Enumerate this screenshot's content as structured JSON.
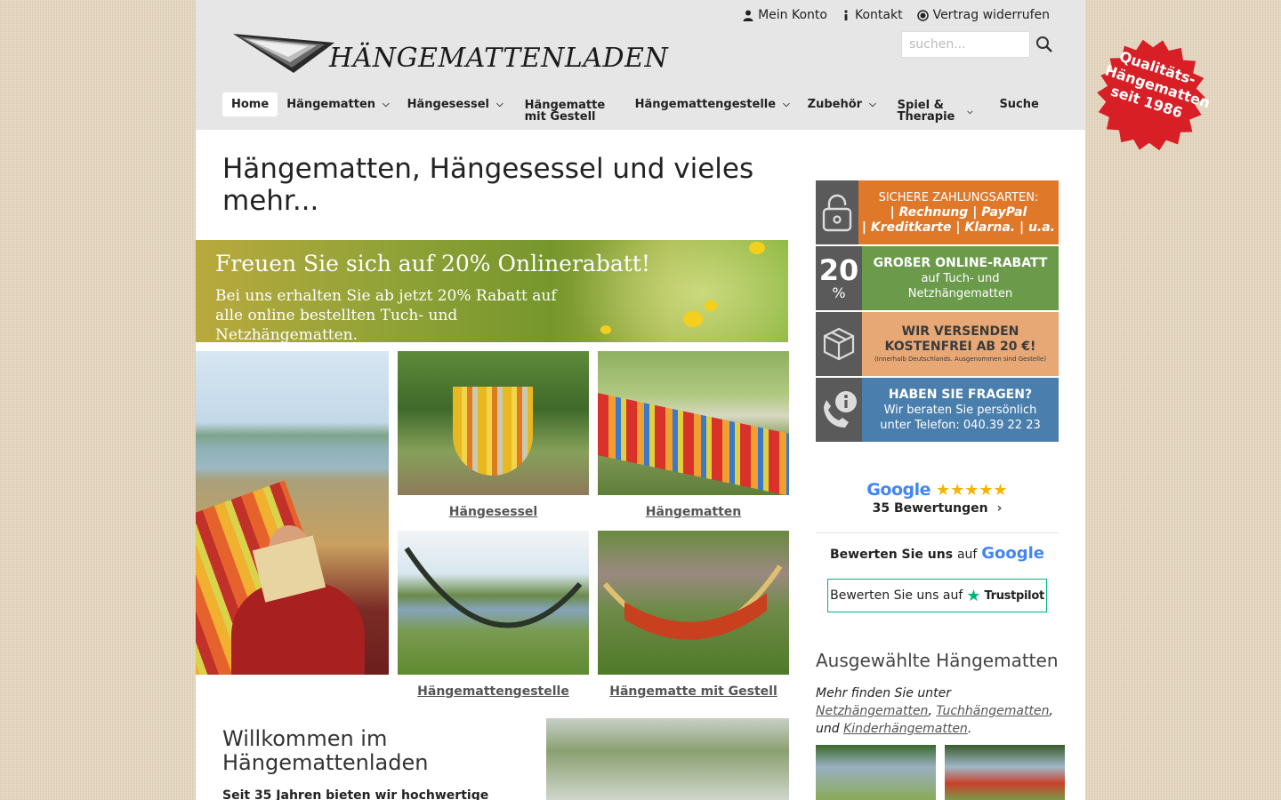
{
  "header": {
    "top_links": [
      {
        "label": "Mein Konto",
        "icon": "user-icon"
      },
      {
        "label": "Kontakt",
        "icon": "info-icon"
      },
      {
        "label": "Vertrag widerrufen",
        "icon": "radio-icon"
      }
    ],
    "logo_text": "HÄNGEMATTENLADEN",
    "search_placeholder": "suchen...",
    "nav": [
      {
        "label": "Home",
        "active": true
      },
      {
        "label": "Hängematten",
        "dropdown": true
      },
      {
        "label": "Hängesessel",
        "dropdown": true
      },
      {
        "label": "Hängematte",
        "label2": "mit Gestell"
      },
      {
        "label": "Hängemattengestelle",
        "dropdown": true
      },
      {
        "label": "Zubehör",
        "dropdown": true
      },
      {
        "label": "Spiel &",
        "label2": "Therapie",
        "dropdown": true
      },
      {
        "label": "Suche"
      }
    ]
  },
  "seal": {
    "line1": "Qualitäts-",
    "line2": "Hängematten",
    "line3": "seit 1986"
  },
  "main": {
    "title": "Hängematten, Hängesessel und vieles mehr...",
    "promo": {
      "title": "Freuen Sie sich auf 20% Onlinerabatt!",
      "text": "Bei uns erhalten Sie ab jetzt 20% Rabatt auf alle online bestellten Tuch- und Netzhängematten."
    },
    "categories": [
      "Hängesessel",
      "Hängematten",
      "Hängemattengestelle",
      "Hängematte mit Gestell"
    ],
    "welcome_title": "Willkommen im Hängemattenladen",
    "welcome_text": "Seit 35 Jahren bieten wir hochwertige"
  },
  "sidebar": {
    "banners": [
      {
        "icon": "lock-icon",
        "color": "#e0782a",
        "line1": "SICHERE ZAHLUNGSARTEN:",
        "line2": "| Rechnung | PayPal",
        "line3": "| Kreditkarte | Klarna. | u.a."
      },
      {
        "icon": "percent-icon",
        "icon_text": "20",
        "icon_sub": "%",
        "color": "#6a9a4a",
        "line1": "GROßER ONLINE-RABATT",
        "line2": "auf Tuch- und",
        "line3": "Netzhängematten"
      },
      {
        "icon": "box-icon",
        "color": "#e7a875",
        "line1": "WIR VERSENDEN",
        "line2": "KOSTENFREI AB 20 €!",
        "line3": "(Innerhalb Deutschlands. Ausgenommen sind Gestelle)"
      },
      {
        "icon": "phone-info-icon",
        "color": "#4a7fad",
        "line1": "HABEN SIE FRAGEN?",
        "line2": "Wir beraten Sie persönlich",
        "line3": "unter Telefon: 040.39 22 23"
      }
    ],
    "google": {
      "brand": "Google",
      "stars": "★★★★★",
      "reviews": "35 Bewertungen",
      "rate_prefix": "Bewerten Sie uns",
      "rate_auf": "auf",
      "rate_brand": "Google"
    },
    "trustpilot": {
      "label": "Bewerten Sie uns auf",
      "brand": "Trustpilot"
    },
    "featured_title": "Ausgewählte Hängematten",
    "featured_text_prefix": "Mehr finden Sie unter",
    "featured_links": [
      "Netzhängematten",
      "Tuchhängematten",
      "Kinderhängematten"
    ],
    "featured_and": "und"
  }
}
